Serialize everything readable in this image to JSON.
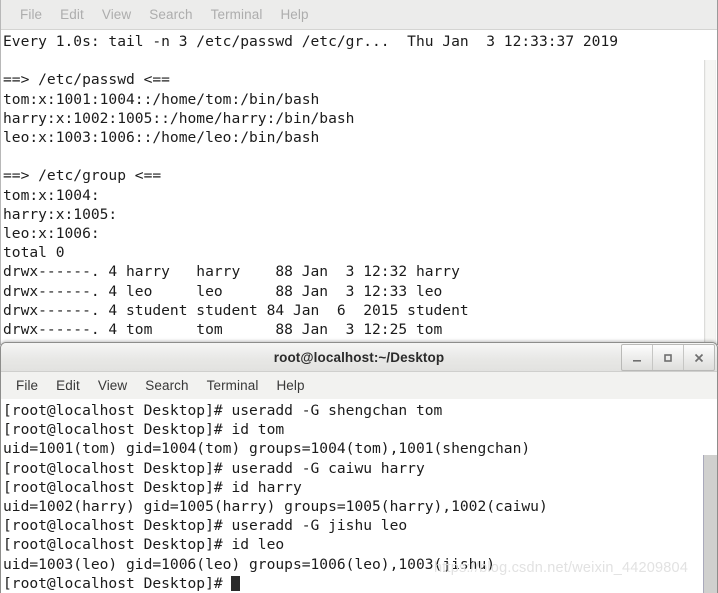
{
  "watch_window": {
    "menu": [
      {
        "label": "File",
        "name": "menu-file"
      },
      {
        "label": "Edit",
        "name": "menu-edit"
      },
      {
        "label": "View",
        "name": "menu-view"
      },
      {
        "label": "Search",
        "name": "menu-search"
      },
      {
        "label": "Terminal",
        "name": "menu-terminal"
      },
      {
        "label": "Help",
        "name": "menu-help"
      }
    ],
    "header": "Every 1.0s: tail -n 3 /etc/passwd /etc/gr...  Thu Jan  3 12:33:37 2019",
    "lines": [
      "",
      "==> /etc/passwd <==",
      "tom:x:1001:1004::/home/tom:/bin/bash",
      "harry:x:1002:1005::/home/harry:/bin/bash",
      "leo:x:1003:1006::/home/leo:/bin/bash",
      "",
      "==> /etc/group <==",
      "tom:x:1004:",
      "harry:x:1005:",
      "leo:x:1006:",
      "total 0",
      "drwx------. 4 harry   harry    88 Jan  3 12:32 harry",
      "drwx------. 4 leo     leo      88 Jan  3 12:33 leo",
      "drwx------. 4 student student 84 Jan  6  2015 student",
      "drwx------. 4 tom     tom      88 Jan  3 12:25 tom"
    ]
  },
  "shell_window": {
    "title": "root@localhost:~/Desktop",
    "window_buttons": [
      {
        "name": "minimize-button",
        "glyph": "minimize-icon"
      },
      {
        "name": "maximize-button",
        "glyph": "maximize-icon"
      },
      {
        "name": "close-button",
        "glyph": "close-icon"
      }
    ],
    "menu": [
      {
        "label": "File",
        "name": "menu-file"
      },
      {
        "label": "Edit",
        "name": "menu-edit"
      },
      {
        "label": "View",
        "name": "menu-view"
      },
      {
        "label": "Search",
        "name": "menu-search"
      },
      {
        "label": "Terminal",
        "name": "menu-terminal"
      },
      {
        "label": "Help",
        "name": "menu-help"
      }
    ],
    "lines": [
      "[root@localhost Desktop]# useradd -G shengchan tom",
      "[root@localhost Desktop]# id tom",
      "uid=1001(tom) gid=1004(tom) groups=1004(tom),1001(shengchan)",
      "[root@localhost Desktop]# useradd -G caiwu harry",
      "[root@localhost Desktop]# id harry",
      "uid=1002(harry) gid=1005(harry) groups=1005(harry),1002(caiwu)",
      "[root@localhost Desktop]# useradd -G jishu leo",
      "[root@localhost Desktop]# id leo",
      "uid=1003(leo) gid=1006(leo) groups=1006(leo),1003(jishu)"
    ],
    "prompt": "[root@localhost Desktop]# "
  },
  "watermark": "https://blog.csdn.net/weixin_44209804"
}
